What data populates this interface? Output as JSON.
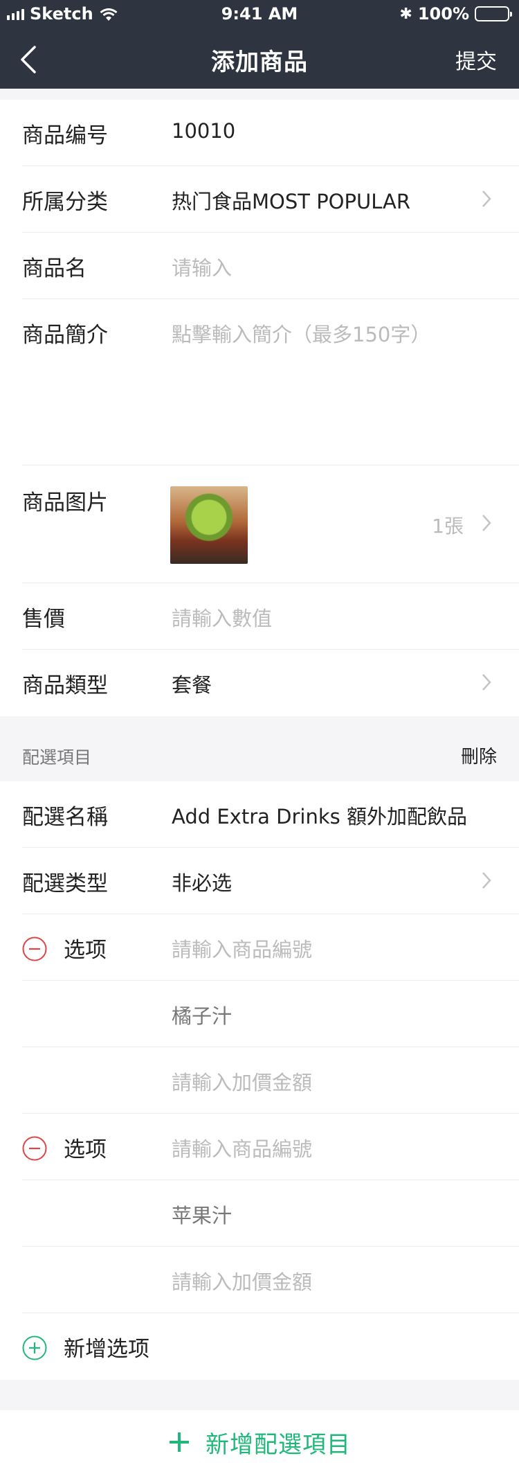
{
  "status_bar": {
    "carrier": "Sketch",
    "time": "9:41 AM",
    "battery": "100%"
  },
  "nav": {
    "title": "添加商品",
    "submit": "提交"
  },
  "form": {
    "product_no": {
      "label": "商品编号",
      "value": "10010"
    },
    "category": {
      "label": "所属分类",
      "value": "热门食品MOST POPULAR"
    },
    "name": {
      "label": "商品名",
      "placeholder": "请输入"
    },
    "intro": {
      "label": "商品簡介",
      "placeholder": "點擊輸入簡介（最多150字）"
    },
    "images": {
      "label": "商品图片",
      "count": "1張"
    },
    "price": {
      "label": "售價",
      "placeholder": "請輸入數值"
    },
    "type": {
      "label": "商品類型",
      "value": "套餐"
    }
  },
  "options_group": {
    "header": "配選項目",
    "delete": "刪除",
    "name": {
      "label": "配選名稱",
      "value": "Add Extra Drinks 額外加配飲品"
    },
    "type": {
      "label": "配選类型",
      "value": "非必选"
    },
    "options": [
      {
        "label": "选项",
        "code_placeholder": "請輸入商品編號",
        "name": "橘子汁",
        "price_placeholder": "請輸入加價金額"
      },
      {
        "label": "选项",
        "code_placeholder": "請輸入商品編號",
        "name": "苹果汁",
        "price_placeholder": "請輸入加價金額"
      }
    ],
    "add_option": "新增选项"
  },
  "add_group": "新增配選項目",
  "colors": {
    "header_bg": "#2f3540",
    "accent_green": "#1fb87a",
    "remove_red": "#e04444"
  }
}
